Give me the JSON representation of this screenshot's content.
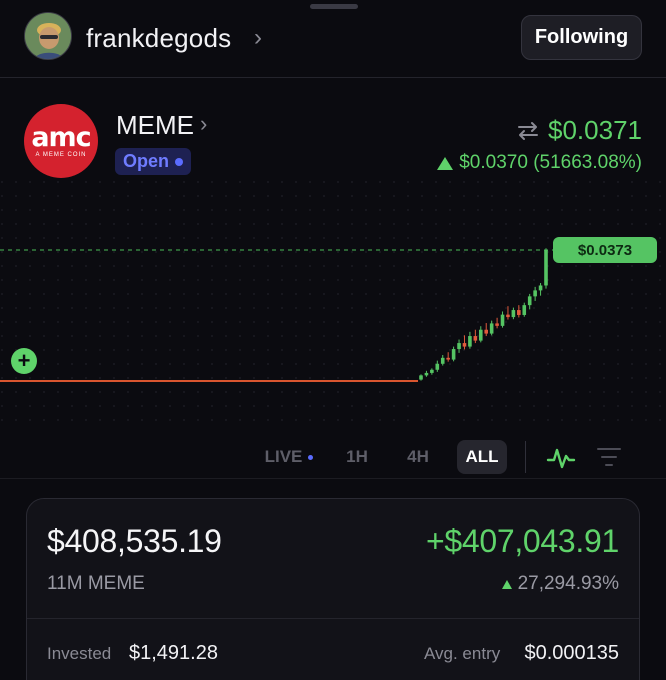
{
  "header": {
    "username": "frankdegods",
    "follow_label": "Following"
  },
  "coin": {
    "logo_text": "amc",
    "logo_subtext": "A MEME COIN",
    "name": "MEME",
    "status": "Open",
    "price": "$0.0371",
    "change": "$0.0370 (51663.08%)"
  },
  "chart": {
    "current_tag": "$0.0373",
    "up_color": "#55c463",
    "down_color": "#e05a3c",
    "baseline_color": "#d9552f"
  },
  "chart_data": {
    "type": "candlestick",
    "title": "",
    "xlabel": "",
    "ylabel": "",
    "current_price": 0.0373,
    "candles": [
      {
        "o": 0.0004,
        "h": 0.0019,
        "l": 0.0001,
        "c": 0.0016
      },
      {
        "o": 0.0016,
        "h": 0.0029,
        "l": 0.0012,
        "c": 0.0023
      },
      {
        "o": 0.0023,
        "h": 0.0036,
        "l": 0.0018,
        "c": 0.0032
      },
      {
        "o": 0.0032,
        "h": 0.0058,
        "l": 0.0026,
        "c": 0.0049
      },
      {
        "o": 0.0049,
        "h": 0.0074,
        "l": 0.0044,
        "c": 0.0066
      },
      {
        "o": 0.0066,
        "h": 0.0082,
        "l": 0.0055,
        "c": 0.0061
      },
      {
        "o": 0.0061,
        "h": 0.0098,
        "l": 0.0056,
        "c": 0.0091
      },
      {
        "o": 0.0091,
        "h": 0.0118,
        "l": 0.008,
        "c": 0.0108
      },
      {
        "o": 0.0108,
        "h": 0.013,
        "l": 0.009,
        "c": 0.0098
      },
      {
        "o": 0.0098,
        "h": 0.014,
        "l": 0.0092,
        "c": 0.0128
      },
      {
        "o": 0.0128,
        "h": 0.0146,
        "l": 0.0108,
        "c": 0.0115
      },
      {
        "o": 0.0115,
        "h": 0.0156,
        "l": 0.011,
        "c": 0.0146
      },
      {
        "o": 0.0146,
        "h": 0.0165,
        "l": 0.0128,
        "c": 0.0135
      },
      {
        "o": 0.0135,
        "h": 0.0172,
        "l": 0.013,
        "c": 0.0164
      },
      {
        "o": 0.0164,
        "h": 0.018,
        "l": 0.015,
        "c": 0.0157
      },
      {
        "o": 0.0157,
        "h": 0.0198,
        "l": 0.0152,
        "c": 0.0189
      },
      {
        "o": 0.0189,
        "h": 0.0213,
        "l": 0.0175,
        "c": 0.0182
      },
      {
        "o": 0.0182,
        "h": 0.0209,
        "l": 0.0176,
        "c": 0.0202
      },
      {
        "o": 0.0202,
        "h": 0.0216,
        "l": 0.0181,
        "c": 0.0188
      },
      {
        "o": 0.0188,
        "h": 0.0223,
        "l": 0.0183,
        "c": 0.0216
      },
      {
        "o": 0.0216,
        "h": 0.0248,
        "l": 0.0204,
        "c": 0.0241
      },
      {
        "o": 0.0241,
        "h": 0.0268,
        "l": 0.0228,
        "c": 0.0258
      },
      {
        "o": 0.0258,
        "h": 0.0279,
        "l": 0.0243,
        "c": 0.0272
      },
      {
        "o": 0.0272,
        "h": 0.0378,
        "l": 0.0263,
        "c": 0.0373
      }
    ]
  },
  "ranges": {
    "live": "LIVE",
    "h1": "1H",
    "h4": "4H",
    "all": "ALL"
  },
  "position": {
    "value": "$408,535.19",
    "profit": "+$407,043.91",
    "quantity": "11M MEME",
    "percent": "27,294.93%",
    "invested_label": "Invested",
    "invested_value": "$1,491.28",
    "avg_label": "Avg. entry",
    "avg_value": "$0.000135"
  }
}
